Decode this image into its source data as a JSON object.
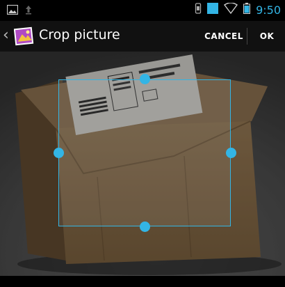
{
  "status_bar": {
    "time": "9:50",
    "icons": [
      "image-notification-icon",
      "upload-notification-icon",
      "vibrate-icon",
      "bluetooth-signal-icon",
      "wifi-icon",
      "battery-icon"
    ],
    "accent_color": "#33b5e5"
  },
  "action_bar": {
    "title": "Crop picture",
    "cancel_label": "CANCEL",
    "ok_label": "OK",
    "app_icon": "gallery-app-icon"
  },
  "editor": {
    "highlight_color": "#33b5e5",
    "handles": [
      "top",
      "left",
      "right",
      "bottom"
    ]
  }
}
